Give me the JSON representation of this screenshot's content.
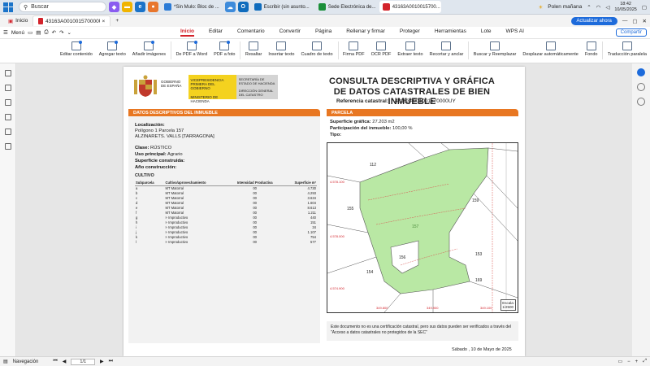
{
  "taskbar": {
    "search_placeholder": "Buscar",
    "tasks": [
      {
        "label": "*Sin Mulo: Bloc de ...",
        "color": "#2b7bd6"
      },
      {
        "label": "",
        "color": "#0f6cbd"
      },
      {
        "label": "Escribir (sin asunto...",
        "color": "#0f6cbd"
      },
      {
        "label": "Sede Electrónica de...",
        "color": "#1a8f3a"
      },
      {
        "label": "43163A0010015700...",
        "color": "#d3232b"
      }
    ],
    "weather": "Polen mañana",
    "time": "18:42",
    "date": "10/05/2025"
  },
  "tabbar": {
    "home_label": "Inicio",
    "active_tab": "43163A001001570000UY (1).pdf",
    "update_label": "Actualizar ahora"
  },
  "menubar": {
    "menu_label": "Menú",
    "tabs": [
      "Inicio",
      "Editar",
      "Comentario",
      "Convertir",
      "Página",
      "Rellenar y firmar",
      "Proteger",
      "Herramientas",
      "Lote",
      "WPS AI"
    ],
    "share_label": "Compartir"
  },
  "toolbar": {
    "tools": [
      "Editar contenido",
      "Agregar texto",
      "Añadir imágenes",
      "De PDF a Word",
      "PDF a foto",
      "Resaltar",
      "Insertar texto",
      "Cuadro de texto",
      "Firma PDF",
      "OCR PDF",
      "Extraer texto",
      "Recortar y anclar",
      "Buscar y Reemplazar",
      "Desplazar automáticamente",
      "Fondo",
      "Traducción paralela"
    ]
  },
  "document": {
    "gobierno": "GOBIERNO DE ESPAÑA",
    "vicepresidencia": "VICEPRESIDENCIA PRIMERA DEL GOBIERNO",
    "ministerio": "MINISTERIO DE HACIENDA",
    "secretaria": "SECRETARÍA DE ESTADO DE HACIENDA",
    "direccion": "DIRECCIÓN GENERAL DEL CATASTRO",
    "title_line1": "CONSULTA DESCRIPTIVA Y GRÁFICA",
    "title_line2": "DE DATOS CATASTRALES DE BIEN INMUEBLE",
    "ref_label": "Referencia catastral:",
    "ref_value": "43163A001001570000UY",
    "left_section": "DATOS DESCRIPTIVOS DEL INMUEBLE",
    "right_section": "PARCELA",
    "localizacion_label": "Localización:",
    "localizacion_line1": "Polígono 1 Parcela 157",
    "localizacion_line2": "ALZINARETS. VALLS [TARRAGONA]",
    "clase_label": "Clase:",
    "clase_value": "RÚSTICO",
    "uso_label": "Uso principal:",
    "uso_value": "Agrario",
    "superficie_const_label": "Superficie construida:",
    "ano_label": "Año construcción:",
    "cultivo_title": "CULTIVO",
    "cultivo_headers": [
      "Subparcela",
      "Cultivo/aprovechamiento",
      "Intensidad Productiva",
      "Superficie m²"
    ],
    "cultivo_rows": [
      [
        "a",
        "MT Matorral",
        "00",
        "4.730"
      ],
      [
        "b",
        "MT Matorral",
        "00",
        "4.293"
      ],
      [
        "c",
        "MT Matorral",
        "00",
        "3.634"
      ],
      [
        "d",
        "MT Matorral",
        "00",
        "1.604"
      ],
      [
        "e",
        "MT Matorral",
        "00",
        "8.613"
      ],
      [
        "f",
        "MT Matorral",
        "00",
        "1.211"
      ],
      [
        "g",
        "I- Improductivo",
        "00",
        "440"
      ],
      [
        "h",
        "I- Improductivo",
        "00",
        "151"
      ],
      [
        "i",
        "I- Improductivo",
        "00",
        "34"
      ],
      [
        "j",
        "I- Improductivo",
        "00",
        "1.107"
      ],
      [
        "k",
        "I- Improductivo",
        "00",
        "754"
      ],
      [
        "l",
        "I- Improductivo",
        "00",
        "577"
      ]
    ],
    "sup_grafica_label": "Superficie gráfica:",
    "sup_grafica_value": "27.203 m2",
    "participacion_label": "Participación del inmueble:",
    "participacion_value": "100,00 %",
    "tipo_label": "Tipo:",
    "map_labels": {
      "p112": "112",
      "p155": "155",
      "p159": "159",
      "p156": "156",
      "p154": "154",
      "p153": "153",
      "p169": "169",
      "p157": "157",
      "y1": "4.578.100",
      "y2": "4.578.000",
      "y3": "4.574.900",
      "x1": "349.800",
      "x2": "349.900",
      "x3": "349.100",
      "escala_label": "Escala:",
      "escala_value": "1/2500"
    },
    "note": "Este documento no es una certificación catastral, pero sus datos pueden ser verificados a través del \"Acceso a datos catastrales no protegidos de la SEC\"",
    "date": "Sábado , 10 de Mayo de 2025"
  },
  "statusbar": {
    "nav_label": "Navegación",
    "page_indicator": "1/1"
  },
  "colors": {
    "accent_red": "#d3232b",
    "orange_band": "#e87722",
    "yellow": "#f4d21f",
    "parcel_green": "#b9e8a4"
  }
}
